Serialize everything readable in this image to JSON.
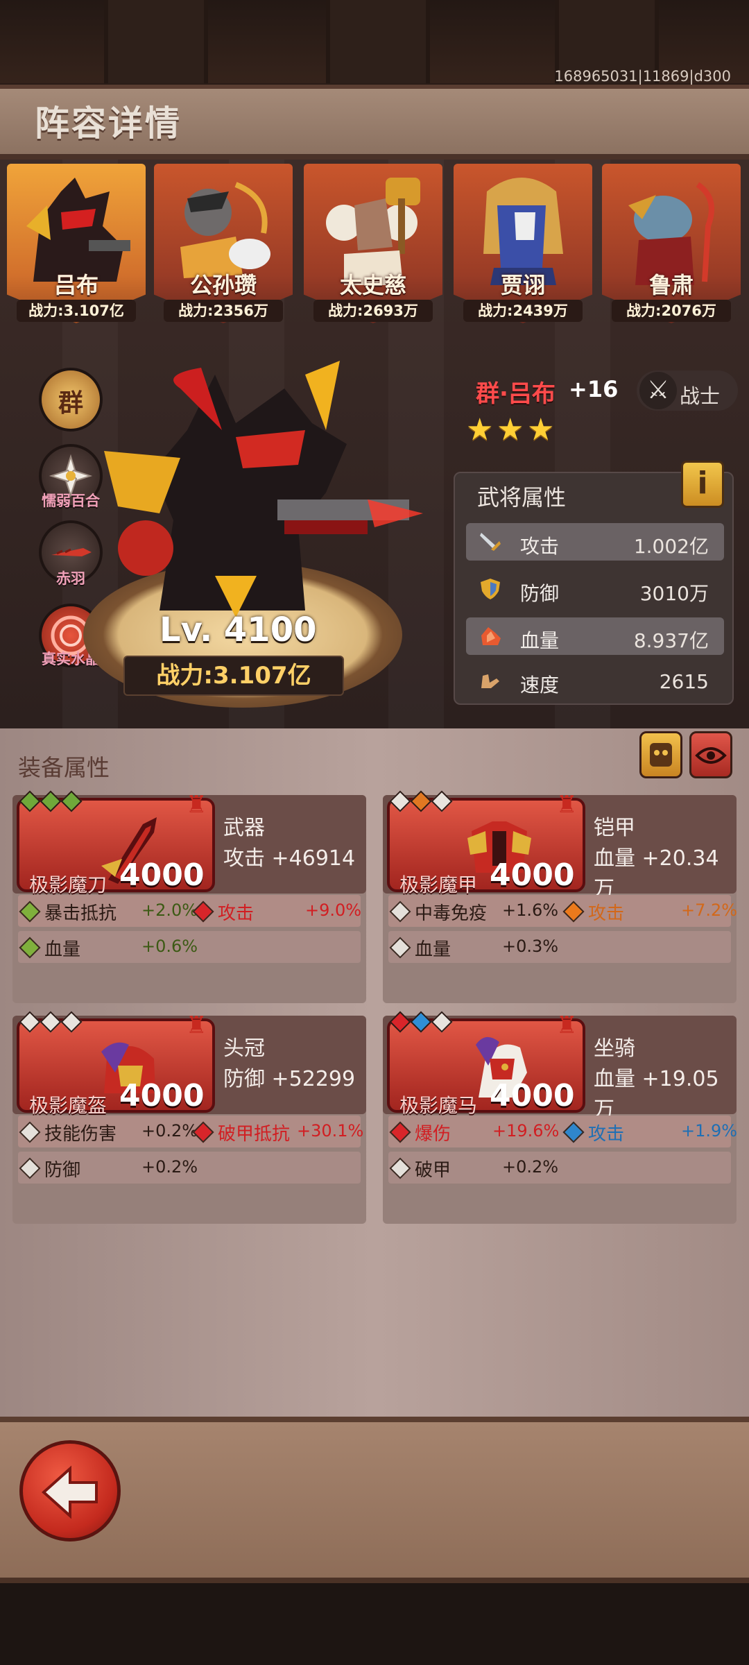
{
  "build_id": "168965031|11869|d300",
  "page_title": "阵容详情",
  "roster": [
    {
      "name": "吕布",
      "power": "战力:3.107亿",
      "active": true
    },
    {
      "name": "公孙瓒",
      "power": "战力:2356万",
      "active": false
    },
    {
      "name": "太史慈",
      "power": "战力:2693万",
      "active": false
    },
    {
      "name": "贾诩",
      "power": "战力:2439万",
      "active": false
    },
    {
      "name": "鲁肃",
      "power": "战力:2076万",
      "active": false
    }
  ],
  "side_badges": {
    "faction": "群",
    "skills": [
      "懦弱百合",
      "赤羽",
      "真实水晶"
    ]
  },
  "hero": {
    "level": "Lv. 4100",
    "power": "战力:3.107亿",
    "faction_name": "群·吕布",
    "plus": "+16",
    "stars": 3,
    "class_label": "战士"
  },
  "attributes": {
    "title": "武将属性",
    "info_icon": "i",
    "rows": [
      {
        "label": "攻击",
        "value": "1.002亿",
        "icon": "sword-icon"
      },
      {
        "label": "防御",
        "value": "3010万",
        "icon": "shield-icon"
      },
      {
        "label": "血量",
        "value": "8.937亿",
        "icon": "blood-icon"
      },
      {
        "label": "速度",
        "value": "2615",
        "icon": "boot-icon"
      }
    ]
  },
  "equipment": {
    "title": "装备属性",
    "items": [
      {
        "slot": "武器",
        "main_stat": "攻击   +46914",
        "item_name": "极影魔刀",
        "level": "4000",
        "gems": [
          "#6fa83a",
          "#6fa83a",
          "#6fa83a"
        ],
        "subs": [
          [
            {
              "name": "暴击抵抗",
              "value": "+2.0%",
              "gem": "#7fb03c",
              "name_color": "#2a1a14",
              "value_color": "#3c5a14"
            },
            {
              "name": "攻击",
              "value": "+9.0%",
              "gem": "#d8252a",
              "name_color": "#d11e22",
              "value_color": "#d11e22"
            }
          ],
          [
            {
              "name": "血量",
              "value": "+0.6%",
              "gem": "#7fb03c",
              "name_color": "#2a1a14",
              "value_color": "#3c5a14"
            }
          ]
        ]
      },
      {
        "slot": "铠甲",
        "main_stat": "血量 +20.34万",
        "item_name": "极影魔甲",
        "level": "4000",
        "gems": [
          "#e8e4de",
          "#e07822",
          "#e8e4de"
        ],
        "subs": [
          [
            {
              "name": "中毒免疫",
              "value": "+1.6%",
              "gem": "#e4e0da",
              "name_color": "#2a1a14",
              "value_color": "#2a1a14"
            },
            {
              "name": "攻击",
              "value": "+7.2%",
              "gem": "#ec7a1c",
              "name_color": "#d2681a",
              "value_color": "#d2681a"
            }
          ],
          [
            {
              "name": "血量",
              "value": "+0.3%",
              "gem": "#e4e0da",
              "name_color": "#2a1a14",
              "value_color": "#2a1a14"
            }
          ]
        ]
      },
      {
        "slot": "头冠",
        "main_stat": "防御   +52299",
        "item_name": "极影魔盔",
        "level": "4000",
        "gems": [
          "#e8e4de",
          "#e8e4de",
          "#e8e4de"
        ],
        "subs": [
          [
            {
              "name": "技能伤害",
              "value": "+0.2%",
              "gem": "#e4e0da",
              "name_color": "#2a1a14",
              "value_color": "#2a1a14"
            },
            {
              "name": "破甲抵抗",
              "value": "+30.1%",
              "gem": "#d8252a",
              "name_color": "#d11e22",
              "value_color": "#d11e22"
            }
          ],
          [
            {
              "name": "防御",
              "value": "+0.2%",
              "gem": "#e4e0da",
              "name_color": "#2a1a14",
              "value_color": "#2a1a14"
            }
          ]
        ]
      },
      {
        "slot": "坐骑",
        "main_stat": "血量 +19.05万",
        "item_name": "极影魔马",
        "level": "4000",
        "gems": [
          "#d8252a",
          "#2f8fd6",
          "#e8e4de"
        ],
        "subs": [
          [
            {
              "name": "爆伤",
              "value": "+19.6%",
              "gem": "#d8252a",
              "name_color": "#d11e22",
              "value_color": "#d11e22"
            },
            {
              "name": "攻击",
              "value": "+1.9%",
              "gem": "#2f86cc",
              "name_color": "#1f6fb4",
              "value_color": "#1f6fb4"
            }
          ],
          [
            {
              "name": "破甲",
              "value": "+0.2%",
              "gem": "#e4e0da",
              "name_color": "#2a1a14",
              "value_color": "#2a1a14"
            }
          ]
        ]
      }
    ]
  },
  "colors": {
    "accent_gold": "#ffd067",
    "banner_red": "#c9562c",
    "banner_gold": "#f0a43a",
    "card_red": "#e15745"
  }
}
